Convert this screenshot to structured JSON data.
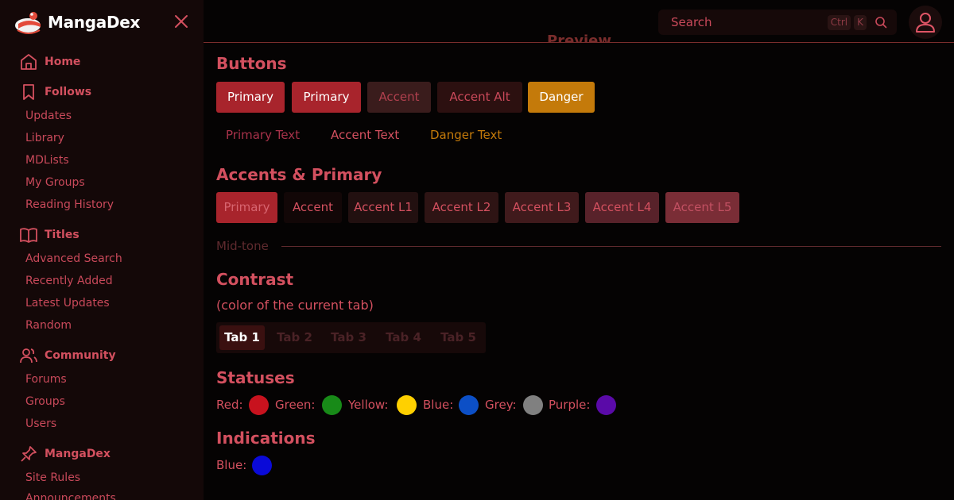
{
  "brand": {
    "name": "MangaDex"
  },
  "sidebar": {
    "sections": [
      {
        "label": "Home",
        "icon": "home-icon"
      },
      {
        "label": "Follows",
        "icon": "bookmark-icon"
      },
      {
        "label": "Titles",
        "icon": "book-icon"
      },
      {
        "label": "Community",
        "icon": "users-icon"
      },
      {
        "label": "MangaDex",
        "icon": "pin-icon"
      }
    ],
    "follows_items": [
      "Updates",
      "Library",
      "MDLists",
      "My Groups",
      "Reading History"
    ],
    "titles_items": [
      "Advanced Search",
      "Recently Added",
      "Latest Updates",
      "Random"
    ],
    "community_items": [
      "Forums",
      "Groups",
      "Users"
    ],
    "mangadex_items": [
      "Site Rules",
      "Announcements"
    ]
  },
  "search": {
    "placeholder": "Search",
    "kbd_ctrl": "Ctrl",
    "kbd_k": "K"
  },
  "main": {
    "preview_heading": "Preview",
    "buttons_heading": "Buttons",
    "buttons": [
      "Primary",
      "Primary",
      "Accent",
      "Accent Alt",
      "Danger"
    ],
    "text_buttons": [
      "Primary Text",
      "Accent Text",
      "Danger Text"
    ],
    "accents_heading": "Accents & Primary",
    "accent_buttons": [
      "Primary",
      "Accent",
      "Accent L1",
      "Accent L2",
      "Accent L3",
      "Accent L4",
      "Accent L5"
    ],
    "midtone_label": "Mid-tone",
    "contrast_heading": "Contrast",
    "contrast_sub": "(color of the current tab)",
    "tabs": [
      "Tab 1",
      "Tab 2",
      "Tab 3",
      "Tab 4",
      "Tab 5"
    ],
    "statuses_heading": "Statuses",
    "statuses": [
      {
        "label": "Red:",
        "color": "#c8121e"
      },
      {
        "label": "Green:",
        "color": "#188a18"
      },
      {
        "label": "Yellow:",
        "color": "#ffd000"
      },
      {
        "label": "Blue:",
        "color": "#0c4fc6"
      },
      {
        "label": "Grey:",
        "color": "#808080"
      },
      {
        "label": "Purple:",
        "color": "#5a0aa8"
      }
    ],
    "indications_heading": "Indications",
    "indications": [
      {
        "label": "Blue:",
        "color": "#0a0ad8"
      }
    ]
  },
  "colors": {
    "primary": "#a8242c",
    "accent": "#3a1c1c",
    "accent_alt": "#2c1010",
    "danger": "#c47a0a",
    "text_primary": "#c9495a"
  }
}
